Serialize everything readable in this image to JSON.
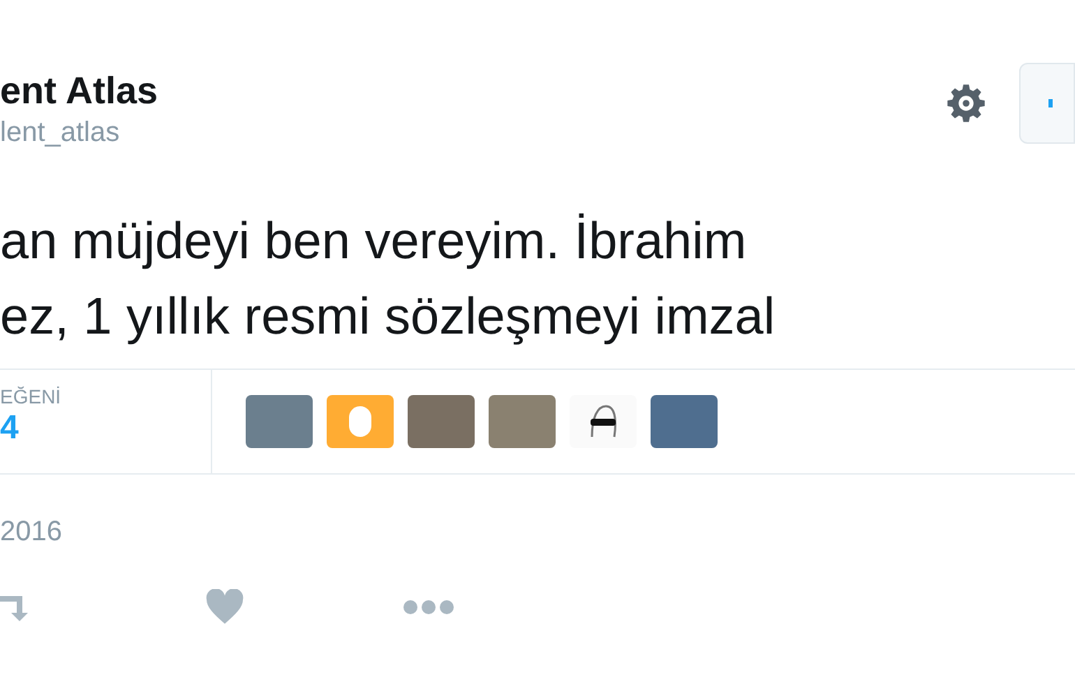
{
  "author": {
    "name": "ent Atlas",
    "handle": "lent_atlas"
  },
  "tweet": {
    "lines": [
      "an müjdeyi ben vereyim. İbrahim",
      "ez, 1 yıllık resmi sözleşmeyi imzal"
    ]
  },
  "stats": {
    "label": "EĞENİ",
    "count": "4"
  },
  "likers": [
    {
      "kind": "photo"
    },
    {
      "kind": "egg"
    },
    {
      "kind": "photo"
    },
    {
      "kind": "photo"
    },
    {
      "kind": "drawing"
    },
    {
      "kind": "photo"
    }
  ],
  "date": "2016"
}
